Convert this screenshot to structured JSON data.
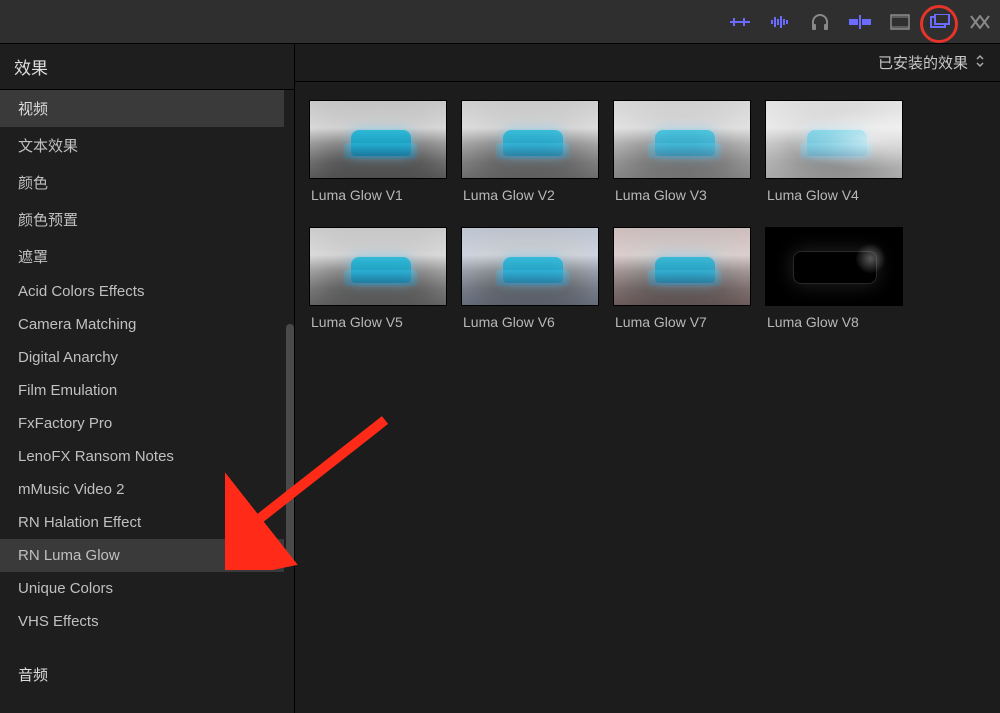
{
  "toolbar": {
    "icons": [
      "levels",
      "waveform",
      "headphones",
      "skimmer",
      "filmstrip",
      "effects",
      "transitions"
    ]
  },
  "sidebar": {
    "title": "效果",
    "section_video": "视频",
    "items": [
      "文本效果",
      "颜色",
      "颜色预置",
      "遮罩",
      "Acid Colors Effects",
      "Camera Matching",
      "Digital Anarchy",
      "Film Emulation",
      "FxFactory Pro",
      "LenoFX Ransom Notes",
      "mMusic Video 2",
      "RN Halation Effect",
      "RN Luma Glow",
      "Unique Colors",
      "VHS Effects"
    ],
    "section_audio": "音频"
  },
  "main": {
    "filter_label": "已安装的效果",
    "effects": [
      {
        "label": "Luma Glow V1",
        "variant": "v1"
      },
      {
        "label": "Luma Glow V2",
        "variant": "v2"
      },
      {
        "label": "Luma Glow V3",
        "variant": "v3"
      },
      {
        "label": "Luma Glow V4",
        "variant": "v4"
      },
      {
        "label": "Luma Glow V5",
        "variant": "v5"
      },
      {
        "label": "Luma Glow V6",
        "variant": "v6"
      },
      {
        "label": "Luma Glow V7",
        "variant": "v7"
      },
      {
        "label": "Luma Glow V8",
        "variant": "v8"
      }
    ]
  }
}
